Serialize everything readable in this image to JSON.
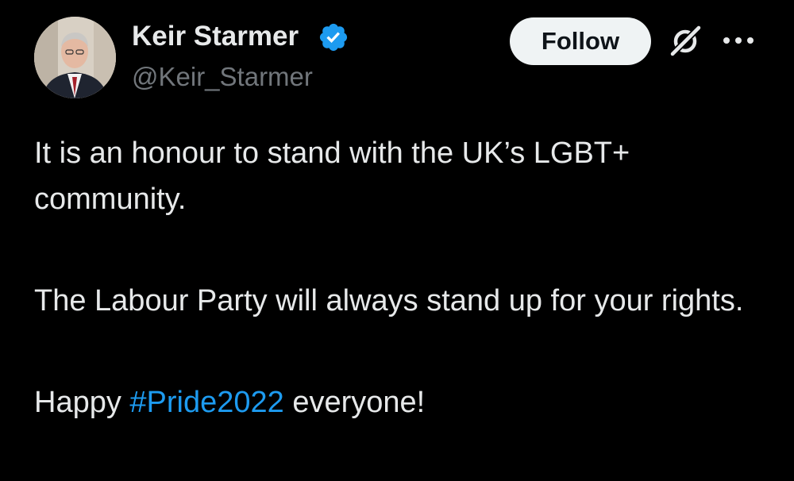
{
  "author": {
    "display_name": "Keir Starmer",
    "handle": "@Keir_Starmer",
    "verified": true
  },
  "actions": {
    "follow_label": "Follow",
    "icons": [
      "grok-icon",
      "more-icon"
    ]
  },
  "tweet": {
    "paragraph_1": "It is an honour to stand with the UK’s LGBT+ community.",
    "paragraph_2": "The Labour Party will always stand up for your rights.",
    "paragraph_3_prefix": "Happy ",
    "hashtag": "#Pride2022",
    "paragraph_3_suffix": " everyone!"
  },
  "colors": {
    "background": "#000000",
    "text": "#e7e9ea",
    "secondary_text": "#71767b",
    "link": "#1d9bf0",
    "verified_badge": "#1d9bf0",
    "follow_button_bg": "#eff3f4"
  }
}
